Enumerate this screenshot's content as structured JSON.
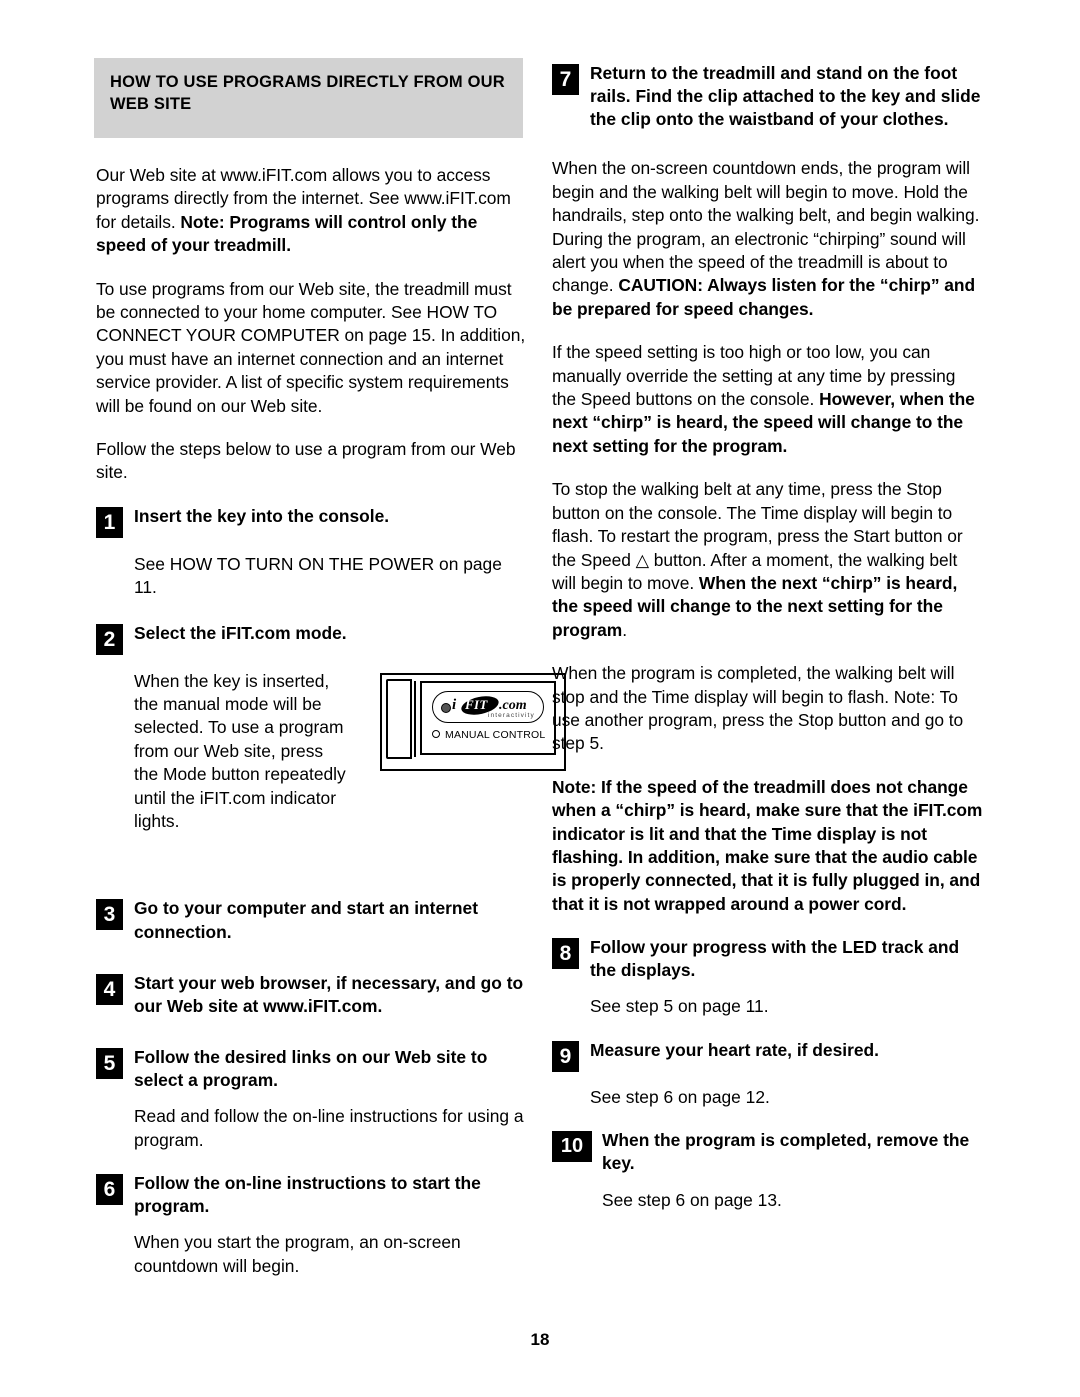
{
  "page": {
    "number": "18"
  },
  "left_column": {
    "section_header": "HOW TO USE PROGRAMS DIRECTLY FROM OUR WEB SITE",
    "intro_paragraph_1_plain": "Our Web site at www.iFIT.com allows you to access programs directly from the internet. See www.iFIT.com for details. ",
    "intro_paragraph_1_bold": "Note: Programs will control only the speed of your treadmill.",
    "intro_paragraph_2": "To use programs from our Web site, the treadmill must be connected to your home computer. See HOW TO CONNECT YOUR COMPUTER on page 15. In addition, you must have an internet connection and an internet service provider. A list of specific system requirements will be found on our Web site.",
    "intro_paragraph_3": "Follow the steps below to use a program from our Web site.",
    "steps": [
      {
        "number": "1",
        "title": "Insert the key into the console.",
        "body": "See HOW TO TURN ON THE POWER on page 11."
      },
      {
        "number": "2",
        "title": "Select the iFIT.com mode.",
        "body": "When the key is inserted, the manual mode will be selected. To use a program from our Web site, press the Mode button repeatedly until the iFIT.com indicator lights."
      },
      {
        "number": "3",
        "title": "Go to your computer and start an internet connection.",
        "body": ""
      },
      {
        "number": "4",
        "title": "Start your web browser, if necessary, and go to our Web site at www.iFIT.com.",
        "body": ""
      },
      {
        "number": "5",
        "title": "Follow the desired links on our Web site to select a program.",
        "body": "Read and follow the on-line instructions for using a program."
      },
      {
        "number": "6",
        "title": "Follow the on-line instructions to start the program.",
        "body": "When you start the program, an on-screen countdown will begin."
      }
    ],
    "figure": {
      "logo_i": "i",
      "logo_fit": "FIT",
      "logo_com": ".com",
      "logo_sub": "interactivity",
      "manual_control_label": "MANUAL CONTROL"
    }
  },
  "right_column": {
    "steps": [
      {
        "number": "7",
        "title": "Return to the treadmill and stand on the foot rails. Find the clip attached to the key and slide the clip onto the waistband of your clothes."
      },
      {
        "number": "8",
        "title": "Follow your progress with the LED track and the displays.",
        "body": "See step 5 on page 11."
      },
      {
        "number": "9",
        "title": "Measure your heart rate, if desired.",
        "body": "See step 6 on page 12."
      },
      {
        "number": "10",
        "title": "When the program is completed, remove the key.",
        "body": "See step 6 on page 13."
      }
    ],
    "paragraph_countdown_plain": "When the on-screen countdown ends, the program will begin and the walking belt will begin to move. Hold the handrails, step onto the walking belt, and begin walking. During the program, an electronic “chirping” sound will alert you when the speed of the treadmill is about to change. ",
    "paragraph_countdown_bold": "CAUTION: Always listen for the “chirp” and be prepared for speed changes.",
    "paragraph_speed_plain": "If the speed setting is too high or too low, you can manually override the setting at any time by pressing the Speed buttons on the console. ",
    "paragraph_speed_bold": "However, when the next “chirp” is heard, the speed will change to the next setting for the program.",
    "paragraph_stop_plain_1": "To stop the walking belt at any time, press the Stop button on the console. The Time display will begin to flash. To restart the program, press the Start button or the Speed ",
    "paragraph_stop_symbol": "△",
    "paragraph_stop_plain_2": " button. After a moment, the walking belt will begin to move. ",
    "paragraph_stop_bold": "When the next “chirp” is heard, the speed will change to the next setting for the program",
    "paragraph_stop_tail": ".",
    "paragraph_completed": "When the program is completed, the walking belt will stop and the Time display will begin to flash. Note: To use another program, press the Stop button and go to step 5.",
    "paragraph_note_bold": "Note: If the speed of the treadmill does not change when a “chirp” is heard, make sure that the iFIT.com indicator is lit and that the Time display is not flashing. In addition, make sure that the audio cable is properly connected, that it is fully plugged in, and that it is not wrapped around a power cord."
  }
}
